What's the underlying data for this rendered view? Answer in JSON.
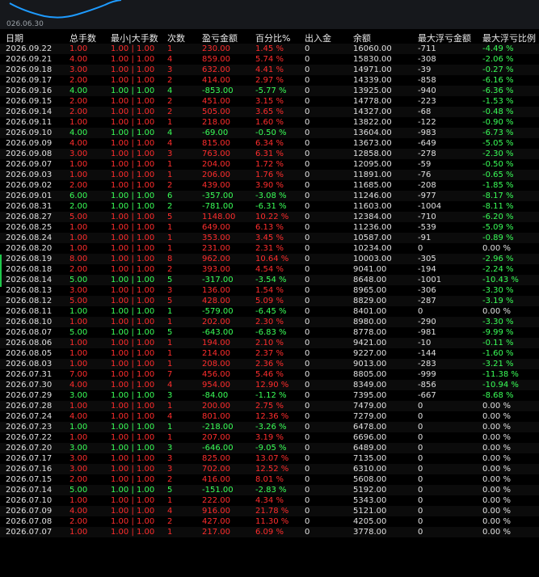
{
  "chart_strip": {
    "date_label": "026.06.30"
  },
  "colors": {
    "profit": "#ff2d2d",
    "loss": "#3aff58",
    "neutral": "#e0e0e0",
    "curve": "#1e9bff"
  },
  "headers": [
    "日期",
    "总手数",
    "最小|大手数",
    "次数",
    "盈亏金额",
    "百分比%",
    "出入金",
    "余额",
    "最大浮亏金额",
    "最大浮亏比例"
  ],
  "rows": [
    [
      "2026.09.22",
      "1.00",
      "1.00 | 1.00",
      "1",
      "230.00",
      "1.45 %",
      "0",
      "16060.00",
      "-711",
      "-4.49 %"
    ],
    [
      "2026.09.21",
      "4.00",
      "1.00 | 1.00",
      "4",
      "859.00",
      "5.74 %",
      "0",
      "15830.00",
      "-308",
      "-2.06 %"
    ],
    [
      "2026.09.18",
      "3.00",
      "1.00 | 1.00",
      "3",
      "632.00",
      "4.41 %",
      "0",
      "14971.00",
      "-39",
      "-0.27 %"
    ],
    [
      "2026.09.17",
      "2.00",
      "1.00 | 1.00",
      "2",
      "414.00",
      "2.97 %",
      "0",
      "14339.00",
      "-858",
      "-6.16 %"
    ],
    [
      "2026.09.16",
      "4.00",
      "1.00 | 1.00",
      "4",
      "-853.00",
      "-5.77 %",
      "0",
      "13925.00",
      "-940",
      "-6.36 %"
    ],
    [
      "2026.09.15",
      "2.00",
      "1.00 | 1.00",
      "2",
      "451.00",
      "3.15 %",
      "0",
      "14778.00",
      "-223",
      "-1.53 %"
    ],
    [
      "2026.09.14",
      "2.00",
      "1.00 | 1.00",
      "2",
      "505.00",
      "3.65 %",
      "0",
      "14327.00",
      "-68",
      "-0.48 %"
    ],
    [
      "2026.09.11",
      "1.00",
      "1.00 | 1.00",
      "1",
      "218.00",
      "1.60 %",
      "0",
      "13822.00",
      "-122",
      "-0.90 %"
    ],
    [
      "2026.09.10",
      "4.00",
      "1.00 | 1.00",
      "4",
      "-69.00",
      "-0.50 %",
      "0",
      "13604.00",
      "-983",
      "-6.73 %"
    ],
    [
      "2026.09.09",
      "4.00",
      "1.00 | 1.00",
      "4",
      "815.00",
      "6.34 %",
      "0",
      "13673.00",
      "-649",
      "-5.05 %"
    ],
    [
      "2026.09.08",
      "3.00",
      "1.00 | 1.00",
      "3",
      "763.00",
      "6.31 %",
      "0",
      "12858.00",
      "-278",
      "-2.30 %"
    ],
    [
      "2026.09.07",
      "1.00",
      "1.00 | 1.00",
      "1",
      "204.00",
      "1.72 %",
      "0",
      "12095.00",
      "-59",
      "-0.50 %"
    ],
    [
      "2026.09.03",
      "1.00",
      "1.00 | 1.00",
      "1",
      "206.00",
      "1.76 %",
      "0",
      "11891.00",
      "-76",
      "-0.65 %"
    ],
    [
      "2026.09.02",
      "2.00",
      "1.00 | 1.00",
      "2",
      "439.00",
      "3.90 %",
      "0",
      "11685.00",
      "-208",
      "-1.85 %"
    ],
    [
      "2026.09.01",
      "6.00",
      "1.00 | 1.00",
      "6",
      "-357.00",
      "-3.08 %",
      "0",
      "11246.00",
      "-977",
      "-8.17 %"
    ],
    [
      "2026.08.31",
      "2.00",
      "1.00 | 1.00",
      "2",
      "-781.00",
      "-6.31 %",
      "0",
      "11603.00",
      "-1004",
      "-8.11 %"
    ],
    [
      "2026.08.27",
      "5.00",
      "1.00 | 1.00",
      "5",
      "1148.00",
      "10.22 %",
      "0",
      "12384.00",
      "-710",
      "-6.20 %"
    ],
    [
      "2026.08.25",
      "1.00",
      "1.00 | 1.00",
      "1",
      "649.00",
      "6.13 %",
      "0",
      "11236.00",
      "-539",
      "-5.09 %"
    ],
    [
      "2026.08.24",
      "1.00",
      "1.00 | 1.00",
      "1",
      "353.00",
      "3.45 %",
      "0",
      "10587.00",
      "-91",
      "-0.89 %"
    ],
    [
      "2026.08.20",
      "1.00",
      "1.00 | 1.00",
      "1",
      "231.00",
      "2.31 %",
      "0",
      "10234.00",
      "0",
      "0.00 %"
    ],
    [
      "2026.08.19",
      "8.00",
      "1.00 | 1.00",
      "8",
      "962.00",
      "10.64 %",
      "0",
      "10003.00",
      "-305",
      "-2.96 %"
    ],
    [
      "2026.08.18",
      "2.00",
      "1.00 | 1.00",
      "2",
      "393.00",
      "4.54 %",
      "0",
      "9041.00",
      "-194",
      "-2.24 %"
    ],
    [
      "2026.08.14",
      "5.00",
      "1.00 | 1.00",
      "5",
      "-317.00",
      "-3.54 %",
      "0",
      "8648.00",
      "-1001",
      "-10.43 %"
    ],
    [
      "2026.08.13",
      "3.00",
      "1.00 | 1.00",
      "3",
      "136.00",
      "1.54 %",
      "0",
      "8965.00",
      "-306",
      "-3.30 %"
    ],
    [
      "2026.08.12",
      "5.00",
      "1.00 | 1.00",
      "5",
      "428.00",
      "5.09 %",
      "0",
      "8829.00",
      "-287",
      "-3.19 %"
    ],
    [
      "2026.08.11",
      "1.00",
      "1.00 | 1.00",
      "1",
      "-579.00",
      "-6.45 %",
      "0",
      "8401.00",
      "0",
      "0.00 %"
    ],
    [
      "2026.08.10",
      "1.00",
      "1.00 | 1.00",
      "1",
      "202.00",
      "2.30 %",
      "0",
      "8980.00",
      "-290",
      "-3.30 %"
    ],
    [
      "2026.08.07",
      "5.00",
      "1.00 | 1.00",
      "5",
      "-643.00",
      "-6.83 %",
      "0",
      "8778.00",
      "-981",
      "-9.99 %"
    ],
    [
      "2026.08.06",
      "1.00",
      "1.00 | 1.00",
      "1",
      "194.00",
      "2.10 %",
      "0",
      "9421.00",
      "-10",
      "-0.11 %"
    ],
    [
      "2026.08.05",
      "1.00",
      "1.00 | 1.00",
      "1",
      "214.00",
      "2.37 %",
      "0",
      "9227.00",
      "-144",
      "-1.60 %"
    ],
    [
      "2026.08.03",
      "1.00",
      "1.00 | 1.00",
      "1",
      "208.00",
      "2.36 %",
      "0",
      "9013.00",
      "-283",
      "-3.21 %"
    ],
    [
      "2026.07.31",
      "7.00",
      "1.00 | 1.00",
      "7",
      "456.00",
      "5.46 %",
      "0",
      "8805.00",
      "-999",
      "-11.38 %"
    ],
    [
      "2026.07.30",
      "4.00",
      "1.00 | 1.00",
      "4",
      "954.00",
      "12.90 %",
      "0",
      "8349.00",
      "-856",
      "-10.94 %"
    ],
    [
      "2026.07.29",
      "3.00",
      "1.00 | 1.00",
      "3",
      "-84.00",
      "-1.12 %",
      "0",
      "7395.00",
      "-667",
      "-8.68 %"
    ],
    [
      "2026.07.28",
      "1.00",
      "1.00 | 1.00",
      "1",
      "200.00",
      "2.75 %",
      "0",
      "7479.00",
      "0",
      "0.00 %"
    ],
    [
      "2026.07.24",
      "4.00",
      "1.00 | 1.00",
      "4",
      "801.00",
      "12.36 %",
      "0",
      "7279.00",
      "0",
      "0.00 %"
    ],
    [
      "2026.07.23",
      "1.00",
      "1.00 | 1.00",
      "1",
      "-218.00",
      "-3.26 %",
      "0",
      "6478.00",
      "0",
      "0.00 %"
    ],
    [
      "2026.07.22",
      "1.00",
      "1.00 | 1.00",
      "1",
      "207.00",
      "3.19 %",
      "0",
      "6696.00",
      "0",
      "0.00 %"
    ],
    [
      "2026.07.20",
      "3.00",
      "1.00 | 1.00",
      "3",
      "-646.00",
      "-9.05 %",
      "0",
      "6489.00",
      "0",
      "0.00 %"
    ],
    [
      "2026.07.17",
      "3.00",
      "1.00 | 1.00",
      "3",
      "825.00",
      "13.07 %",
      "0",
      "7135.00",
      "0",
      "0.00 %"
    ],
    [
      "2026.07.16",
      "3.00",
      "1.00 | 1.00",
      "3",
      "702.00",
      "12.52 %",
      "0",
      "6310.00",
      "0",
      "0.00 %"
    ],
    [
      "2026.07.15",
      "2.00",
      "1.00 | 1.00",
      "2",
      "416.00",
      "8.01 %",
      "0",
      "5608.00",
      "0",
      "0.00 %"
    ],
    [
      "2026.07.14",
      "5.00",
      "1.00 | 1.00",
      "5",
      "-151.00",
      "-2.83 %",
      "0",
      "5192.00",
      "0",
      "0.00 %"
    ],
    [
      "2026.07.10",
      "1.00",
      "1.00 | 1.00",
      "1",
      "222.00",
      "4.34 %",
      "0",
      "5343.00",
      "0",
      "0.00 %"
    ],
    [
      "2026.07.09",
      "4.00",
      "1.00 | 1.00",
      "4",
      "916.00",
      "21.78 %",
      "0",
      "5121.00",
      "0",
      "0.00 %"
    ],
    [
      "2026.07.08",
      "2.00",
      "1.00 | 1.00",
      "2",
      "427.00",
      "11.30 %",
      "0",
      "4205.00",
      "0",
      "0.00 %"
    ],
    [
      "2026.07.07",
      "1.00",
      "1.00 | 1.00",
      "1",
      "217.00",
      "6.09 %",
      "0",
      "3778.00",
      "0",
      "0.00 %"
    ]
  ]
}
